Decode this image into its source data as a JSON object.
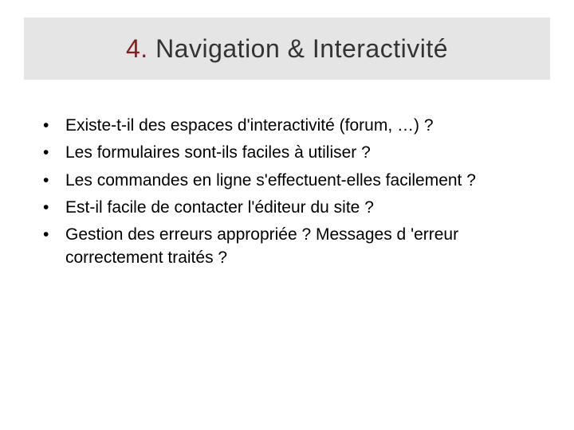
{
  "title": {
    "number": "4.",
    "rest": " Navigation & Interactivité"
  },
  "bullets": [
    "Existe-t-il des espaces d'interactivité (forum, …) ?",
    "Les formulaires sont-ils faciles à utiliser ?",
    "Les commandes en ligne s'effectuent-elles facilement ?",
    "Est-il facile de contacter l'éditeur du site ?",
    "Gestion des erreurs appropriée ? Messages d 'erreur correctement traités ?"
  ]
}
